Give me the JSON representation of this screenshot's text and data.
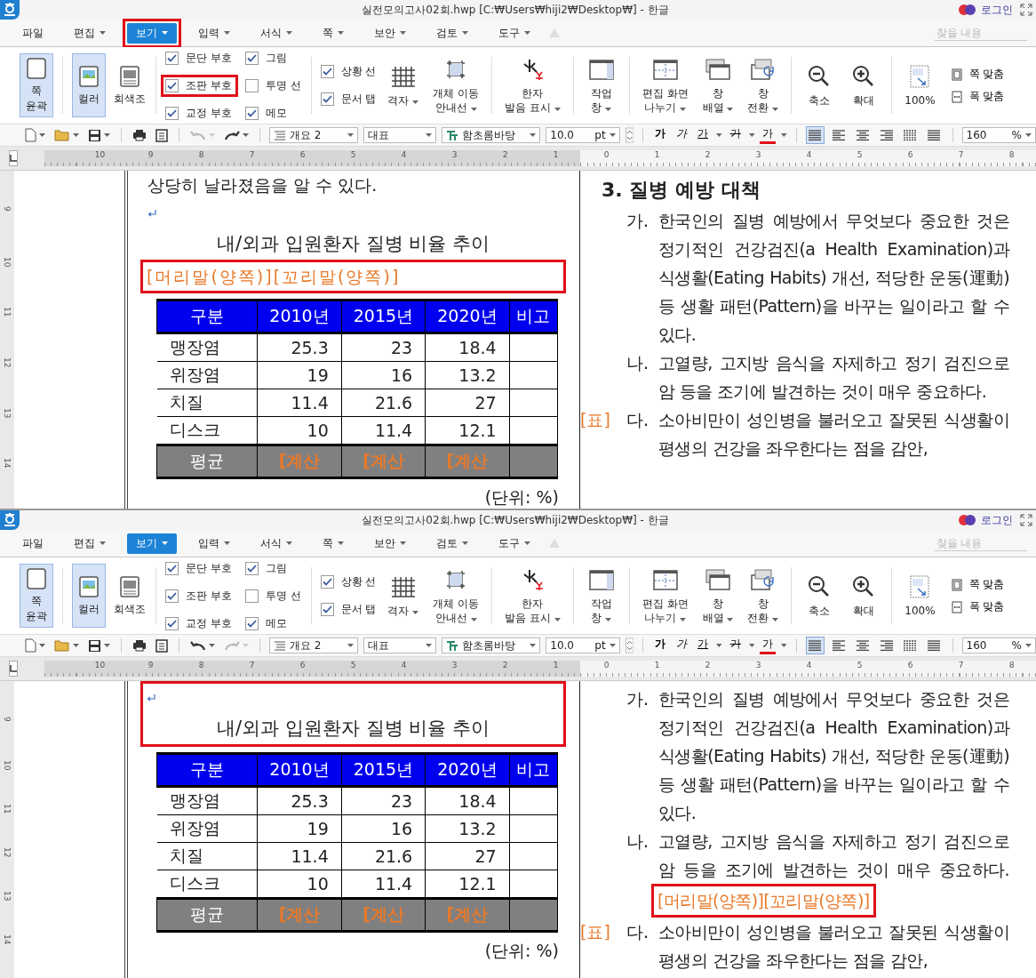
{
  "windows": [
    {
      "title": "실전모의고사02회.hwp [C:₩Users₩hiji2₩Desktop₩] - 한글",
      "login": "로그인",
      "menu": [
        {
          "label": "파일",
          "dropdown": false,
          "selected": false,
          "highlighted": false
        },
        {
          "label": "편집",
          "dropdown": true,
          "selected": false,
          "highlighted": false
        },
        {
          "label": "보기",
          "dropdown": true,
          "selected": true,
          "highlighted": true
        },
        {
          "label": "입력",
          "dropdown": true,
          "selected": false,
          "highlighted": false
        },
        {
          "label": "서식",
          "dropdown": true,
          "selected": false,
          "highlighted": false
        },
        {
          "label": "쪽",
          "dropdown": true,
          "selected": false,
          "highlighted": false
        },
        {
          "label": "보안",
          "dropdown": true,
          "selected": false,
          "highlighted": false
        },
        {
          "label": "검토",
          "dropdown": true,
          "selected": false,
          "highlighted": false
        },
        {
          "label": "도구",
          "dropdown": true,
          "selected": false,
          "highlighted": false
        }
      ],
      "search": {
        "placeholder": "찾을 내용"
      },
      "ribbon": [
        [
          {
            "kind": "page",
            "label": "쪽\n윤곽",
            "selected": true
          }
        ],
        [
          {
            "kind": "color",
            "label": "컬러",
            "selected": true
          },
          {
            "kind": "gray",
            "label": "회색조",
            "selected": false
          }
        ],
        [
          {
            "kind": "checks",
            "columns": [
              [
                {
                  "label": "문단 부호",
                  "checked": true,
                  "highlighted": false
                },
                {
                  "label": "조판 부호",
                  "checked": true,
                  "highlighted": true
                },
                {
                  "label": "교정 부호",
                  "checked": true,
                  "highlighted": false
                }
              ],
              [
                {
                  "label": "그림",
                  "checked": true,
                  "highlighted": false
                },
                {
                  "label": "투명 선",
                  "checked": false,
                  "highlighted": false
                },
                {
                  "label": "메모",
                  "checked": true,
                  "highlighted": false
                }
              ]
            ]
          }
        ],
        [
          {
            "kind": "checks",
            "columns": [
              [
                {
                  "label": "상황 선",
                  "checked": true,
                  "highlighted": false
                },
                {
                  "label": "문서 탭",
                  "checked": true,
                  "highlighted": false
                }
              ]
            ]
          },
          {
            "kind": "grid",
            "label": "격자",
            "dropdown": true
          },
          {
            "kind": "guide",
            "label": "개체 이동\n안내선",
            "dropdown": true
          }
        ],
        [
          {
            "kind": "hanja",
            "label": "한자\n발음 표시",
            "dropdown": true
          }
        ],
        [
          {
            "kind": "pane",
            "label": "작업\n창",
            "dropdown": true
          }
        ],
        [
          {
            "kind": "split",
            "label": "편집 화면\n나누기",
            "dropdown": true
          },
          {
            "kind": "arrange",
            "label": "창\n배열",
            "dropdown": true
          },
          {
            "kind": "switch",
            "label": "창\n전환",
            "dropdown": true
          }
        ],
        [
          {
            "kind": "zoom_out",
            "label": "축소",
            "dropdown": false
          },
          {
            "kind": "zoom_in",
            "label": "확대",
            "dropdown": false
          }
        ],
        [
          {
            "kind": "zoom_100",
            "label": "100%",
            "dropdown": false
          },
          {
            "kind": "fit",
            "items": [
              {
                "kind": "page_fit",
                "label": "쪽 맞춤"
              },
              {
                "kind": "width_fit",
                "label": "폭 맞춤"
              }
            ]
          }
        ]
      ],
      "toolbar": {
        "undo": {
          "disabled": true
        },
        "redo": {
          "disabled": false
        },
        "style_box": "개요 2",
        "para_box": "대표",
        "font_box": "함초롬바탕",
        "size_box": {
          "value": "10.0",
          "unit": "pt"
        },
        "format_buttons": [
          {
            "kind": "bold",
            "label": "가"
          },
          {
            "kind": "italic",
            "label": "가"
          },
          {
            "kind": "underline",
            "label": "가"
          },
          {
            "kind": "strike",
            "label": "가"
          },
          {
            "kind": "color",
            "label": "가"
          }
        ],
        "align_buttons": [
          {
            "kind": "justify",
            "selected": true
          },
          {
            "kind": "left",
            "selected": false
          },
          {
            "kind": "center",
            "selected": false
          },
          {
            "kind": "right",
            "selected": false
          },
          {
            "kind": "distribute",
            "selected": false
          },
          {
            "kind": "split",
            "selected": false
          }
        ],
        "zoom_box": {
          "value": "160",
          "unit": "%"
        }
      },
      "ruler_labels": [
        "10",
        "9",
        "8",
        "7",
        "6",
        "5",
        "4",
        "3",
        "2",
        "1",
        "0",
        "1",
        "2",
        "3",
        "4",
        "5",
        "6",
        "7",
        "8"
      ],
      "side_ruler_labels": [
        "9",
        "10",
        "11",
        "12",
        "13",
        "14"
      ],
      "document": {
        "left": [
          {
            "kind": "text",
            "text": "상당히 날라졌음을 알 수 있다."
          },
          {
            "kind": "blank"
          },
          {
            "kind": "title",
            "text": "내/외과 입원환자 질병 비율 추이"
          },
          {
            "kind": "highlight",
            "children": [
              {
                "kind": "marker",
                "text": "[머리말(양쪽)][꼬리말(양쪽)]"
              }
            ]
          },
          {
            "kind": "table",
            "columns": [
              "구분",
              "2010년",
              "2015년",
              "2020년",
              "비고"
            ],
            "rows": [
              [
                "맹장염",
                "25.3",
                "23",
                "18.4"
              ],
              [
                "위장염",
                "19",
                "16",
                "13.2"
              ],
              [
                "치질",
                "11.4",
                "21.6",
                "27"
              ],
              [
                "디스크",
                "10",
                "11.4",
                "12.1"
              ]
            ],
            "footer": [
              "평균",
              "[계산",
              "[계산",
              "[계산"
            ]
          },
          {
            "kind": "unit",
            "text": "(단위: %)"
          }
        ],
        "right": {
          "heading": "3. 질병 예방 대책",
          "items": [
            {
              "label": "가.",
              "text": "한국인의 질병 예방에서 무엇보다 중요한 것은 정기적인 건강검진(a Health Examination)과 식생활(Eating Habits) 개선, 적당한 운동(運動) 등 생활 패턴(Pattern)을 바꾸는 일이라고 할 수 있다."
            },
            {
              "label": "나.",
              "text": "고열량, 고지방 음식을 자제하고 정기 검진으로 암 등을 조기에 발견하는 것이 매우 중요하다."
            },
            {
              "label": "다.",
              "text": "소아비만이 성인병을 불러오고 잘못된 식생활이 평생의 건강을 좌우한다는 점을 감안,",
              "side_marker": "[표]"
            }
          ]
        }
      }
    },
    {
      "title": "실전모의고사02회.hwp [C:₩Users₩hiji2₩Desktop₩] - 한글",
      "login": "로그인",
      "menu": [
        {
          "label": "파일",
          "dropdown": false,
          "selected": false,
          "highlighted": false
        },
        {
          "label": "편집",
          "dropdown": true,
          "selected": false,
          "highlighted": false
        },
        {
          "label": "보기",
          "dropdown": true,
          "selected": true,
          "highlighted": false
        },
        {
          "label": "입력",
          "dropdown": true,
          "selected": false,
          "highlighted": false
        },
        {
          "label": "서식",
          "dropdown": true,
          "selected": false,
          "highlighted": false
        },
        {
          "label": "쪽",
          "dropdown": true,
          "selected": false,
          "highlighted": false
        },
        {
          "label": "보안",
          "dropdown": true,
          "selected": false,
          "highlighted": false
        },
        {
          "label": "검토",
          "dropdown": true,
          "selected": false,
          "highlighted": false
        },
        {
          "label": "도구",
          "dropdown": true,
          "selected": false,
          "highlighted": false
        }
      ],
      "search": {
        "placeholder": "찾을 내용"
      },
      "ribbon": [
        [
          {
            "kind": "page",
            "label": "쪽\n윤곽",
            "selected": true
          }
        ],
        [
          {
            "kind": "color",
            "label": "컬러",
            "selected": true
          },
          {
            "kind": "gray",
            "label": "회색조",
            "selected": false
          }
        ],
        [
          {
            "kind": "checks",
            "columns": [
              [
                {
                  "label": "문단 부호",
                  "checked": true,
                  "highlighted": false
                },
                {
                  "label": "조판 부호",
                  "checked": true,
                  "highlighted": false
                },
                {
                  "label": "교정 부호",
                  "checked": true,
                  "highlighted": false
                }
              ],
              [
                {
                  "label": "그림",
                  "checked": true,
                  "highlighted": false
                },
                {
                  "label": "투명 선",
                  "checked": false,
                  "highlighted": false
                },
                {
                  "label": "메모",
                  "checked": true,
                  "highlighted": false
                }
              ]
            ]
          }
        ],
        [
          {
            "kind": "checks",
            "columns": [
              [
                {
                  "label": "상황 선",
                  "checked": true,
                  "highlighted": false
                },
                {
                  "label": "문서 탭",
                  "checked": true,
                  "highlighted": false
                }
              ]
            ]
          },
          {
            "kind": "grid",
            "label": "격자",
            "dropdown": true
          },
          {
            "kind": "guide",
            "label": "개체 이동\n안내선",
            "dropdown": true
          }
        ],
        [
          {
            "kind": "hanja",
            "label": "한자\n발음 표시",
            "dropdown": true
          }
        ],
        [
          {
            "kind": "pane",
            "label": "작업\n창",
            "dropdown": true
          }
        ],
        [
          {
            "kind": "split",
            "label": "편집 화면\n나누기",
            "dropdown": true
          },
          {
            "kind": "arrange",
            "label": "창\n배열",
            "dropdown": true
          },
          {
            "kind": "switch",
            "label": "창\n전환",
            "dropdown": true
          }
        ],
        [
          {
            "kind": "zoom_out",
            "label": "축소",
            "dropdown": false
          },
          {
            "kind": "zoom_in",
            "label": "확대",
            "dropdown": false
          }
        ],
        [
          {
            "kind": "zoom_100",
            "label": "100%",
            "dropdown": false
          },
          {
            "kind": "fit",
            "items": [
              {
                "kind": "page_fit",
                "label": "쪽 맞춤"
              },
              {
                "kind": "width_fit",
                "label": "폭 맞춤"
              }
            ]
          }
        ]
      ],
      "toolbar": {
        "undo": {
          "disabled": false
        },
        "redo": {
          "disabled": true
        },
        "style_box": "개요 2",
        "para_box": "대표",
        "font_box": "함초롬바탕",
        "size_box": {
          "value": "10.0",
          "unit": "pt"
        },
        "format_buttons": [
          {
            "kind": "bold",
            "label": "가"
          },
          {
            "kind": "italic",
            "label": "가"
          },
          {
            "kind": "underline",
            "label": "가"
          },
          {
            "kind": "strike",
            "label": "가"
          },
          {
            "kind": "color",
            "label": "가"
          }
        ],
        "align_buttons": [
          {
            "kind": "justify",
            "selected": true
          },
          {
            "kind": "left",
            "selected": false
          },
          {
            "kind": "center",
            "selected": false
          },
          {
            "kind": "right",
            "selected": false
          },
          {
            "kind": "distribute",
            "selected": false
          },
          {
            "kind": "split",
            "selected": false
          }
        ],
        "zoom_box": {
          "value": "160",
          "unit": "%"
        }
      },
      "ruler_labels": [
        "10",
        "9",
        "8",
        "7",
        "6",
        "5",
        "4",
        "3",
        "2",
        "1",
        "0",
        "1",
        "2",
        "3",
        "4",
        "5",
        "6",
        "7",
        "8"
      ],
      "side_ruler_labels": [
        "9",
        "10",
        "11",
        "12",
        "13",
        "14"
      ],
      "document": {
        "left": [
          {
            "kind": "highlight",
            "children": [
              {
                "kind": "blank"
              },
              {
                "kind": "title",
                "text": "내/외과 입원환자 질병 비율 추이"
              }
            ]
          },
          {
            "kind": "table",
            "columns": [
              "구분",
              "2010년",
              "2015년",
              "2020년",
              "비고"
            ],
            "rows": [
              [
                "맹장염",
                "25.3",
                "23",
                "18.4"
              ],
              [
                "위장염",
                "19",
                "16",
                "13.2"
              ],
              [
                "치질",
                "11.4",
                "21.6",
                "27"
              ],
              [
                "디스크",
                "10",
                "11.4",
                "12.1"
              ]
            ],
            "footer": [
              "평균",
              "[계산",
              "[계산",
              "[계산"
            ]
          },
          {
            "kind": "unit",
            "text": "(단위: %)"
          }
        ],
        "right": {
          "items": [
            {
              "label": "가.",
              "text": "한국인의 질병 예방에서 무엇보다 중요한 것은 정기적인 건강검진(a Health Examination)과 식생활(Eating Habits) 개선, 적당한 운동(運動) 등 생활 패턴(Pattern)을 바꾸는 일이라고 할 수 있다."
            },
            {
              "label": "나.",
              "text": "고열량, 고지방 음식을 자제하고 정기 검진으로 암 등을 조기에 발견하는 것이 매우 중요하다.",
              "inline_marker": {
                "text": "[머리말(양쪽)][꼬리말(양쪽)]",
                "highlighted": true
              }
            },
            {
              "label": "다.",
              "text": "소아비만이 성인병을 불러오고 잘못된 식생활이 평생의 건강을 좌우한다는 점을 감안,",
              "side_marker": "[표]"
            }
          ]
        }
      }
    }
  ]
}
